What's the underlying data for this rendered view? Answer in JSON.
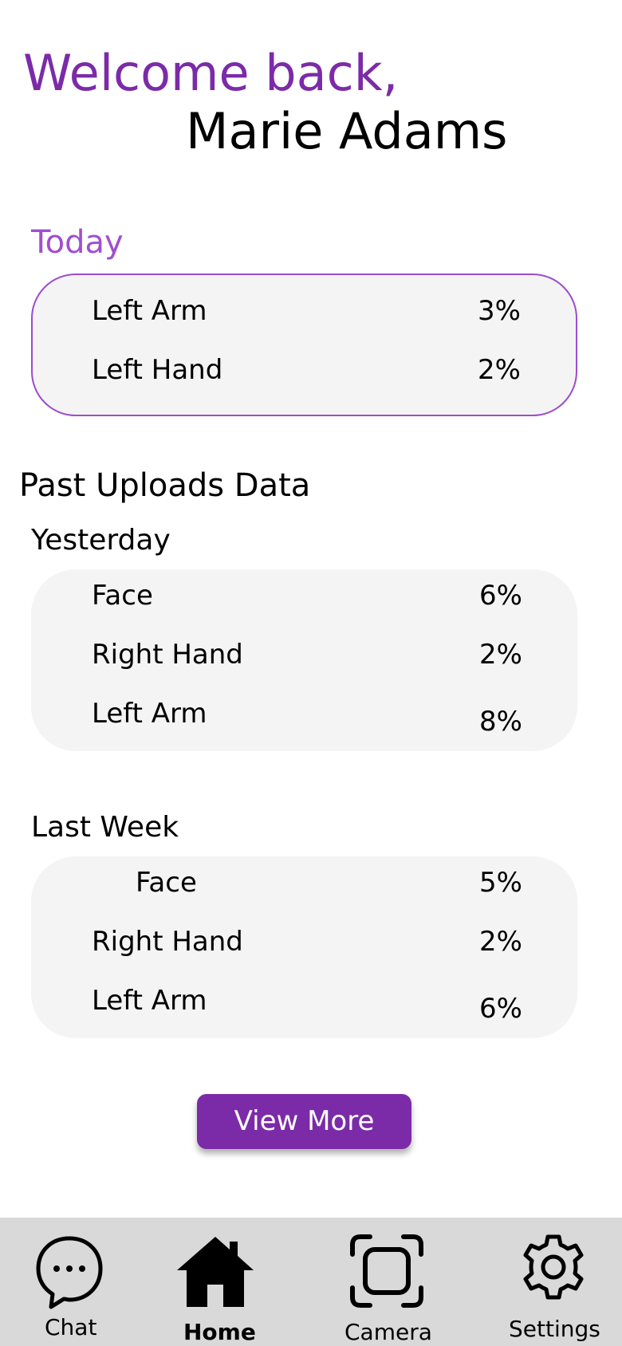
{
  "header": {
    "welcome_text": "Welcome back,",
    "user_name": "Marie Adams"
  },
  "today": {
    "label": "Today",
    "rows": [
      {
        "label": "Left Arm",
        "value": "3%"
      },
      {
        "label": "Left Hand",
        "value": "2%"
      }
    ]
  },
  "past_uploads": {
    "title": "Past Uploads Data",
    "groups": [
      {
        "label": "Yesterday",
        "rows": [
          {
            "label": "Face",
            "value": "6%"
          },
          {
            "label": "Right Hand",
            "value": "2%"
          },
          {
            "label": "Left Arm",
            "value": "8%"
          }
        ]
      },
      {
        "label": "Last Week",
        "rows": [
          {
            "label": "Face",
            "value": "5%"
          },
          {
            "label": "Right Hand",
            "value": "2%"
          },
          {
            "label": "Left Arm",
            "value": "6%"
          }
        ]
      }
    ]
  },
  "view_more_label": "View More",
  "nav": {
    "items": [
      {
        "label": "Chat",
        "icon": "chat-bubble-icon"
      },
      {
        "label": "Home",
        "icon": "home-icon",
        "active": true
      },
      {
        "label": "Camera",
        "icon": "camera-frame-icon"
      },
      {
        "label": "Settings",
        "icon": "gear-icon"
      }
    ]
  },
  "colors": {
    "accent": "#7b2ba8",
    "accent_light": "#a04fcf",
    "card_background": "#f4f4f4",
    "nav_background": "#d9d9d9"
  }
}
